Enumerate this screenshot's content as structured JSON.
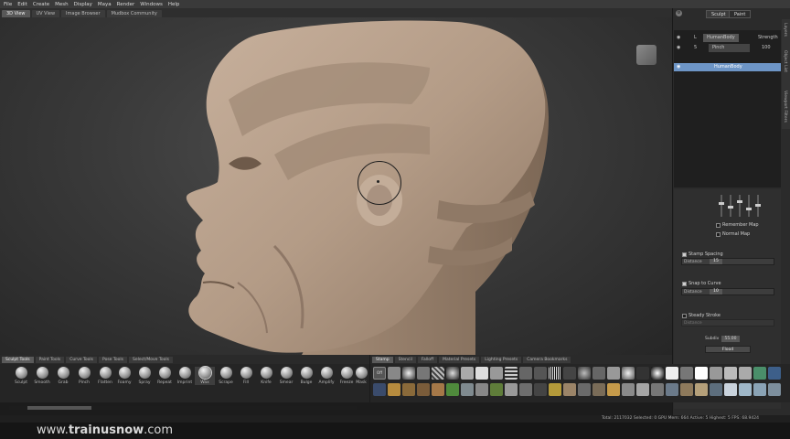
{
  "menu": [
    "File",
    "Edit",
    "Create",
    "Mesh",
    "Display",
    "Maya",
    "Render",
    "Windows",
    "Help"
  ],
  "view_tabs": [
    "3D View",
    "UV View",
    "Image Browser",
    "Mudbox Community"
  ],
  "right_panel": {
    "tabs": [
      "Sculpt",
      "Paint"
    ],
    "layers": [
      {
        "eye": "",
        "lock": "",
        "name": "HumanBody",
        "value": "Strength"
      },
      {
        "eye": "",
        "lock": "5",
        "name": "Pinch",
        "value": "100"
      },
      {
        "eye": "",
        "lock": "",
        "name": "HumanBody",
        "value": ""
      }
    ],
    "side_tabs": [
      "Layers",
      "Object List",
      "Viewport Filters"
    ],
    "mirror": "Remember Map",
    "normal_map": "Normal Map",
    "stamp_spacing": {
      "label": "Stamp Spacing",
      "field": "Distance",
      "value": "15"
    },
    "snap_to_curve": {
      "label": "Snap to Curve",
      "field": "Distance",
      "value": "10"
    },
    "steady_stroke": {
      "label": "Steady Stroke",
      "field": "Distance",
      "value": ""
    },
    "bottom": {
      "subdiv_label": "Subdiv",
      "subdiv_value": "55.00",
      "button": "Flood"
    }
  },
  "bottom_left_tabs": [
    "Sculpt Tools",
    "Paint Tools",
    "Curve Tools",
    "Pose Tools",
    "Select/Move Tools"
  ],
  "tools": [
    "Sculpt",
    "Smooth",
    "Grab",
    "Pinch",
    "Flatten",
    "Foamy",
    "Spray",
    "Repeat",
    "Imprint",
    "Wax",
    "Scrape",
    "Fill",
    "Knife",
    "Smear",
    "Bulge",
    "Amplify",
    "Freeze",
    "Mask"
  ],
  "active_tool": "Wax",
  "bottom_right_tabs": [
    "Stamp",
    "Stencil",
    "Falloff",
    "Material Presets",
    "Lighting Presets",
    "Camera Bookmarks"
  ],
  "status": "Total: 2117032  Selected: 0  GPU Mem: 664  Active: 5  Highest: 5  FPS: 68.9424",
  "watermark": {
    "prefix": "www.",
    "brand": "trainusnow",
    "suffix": ".com"
  },
  "colors": {
    "skin": "#b59d88",
    "selection": "#6d95c6"
  }
}
